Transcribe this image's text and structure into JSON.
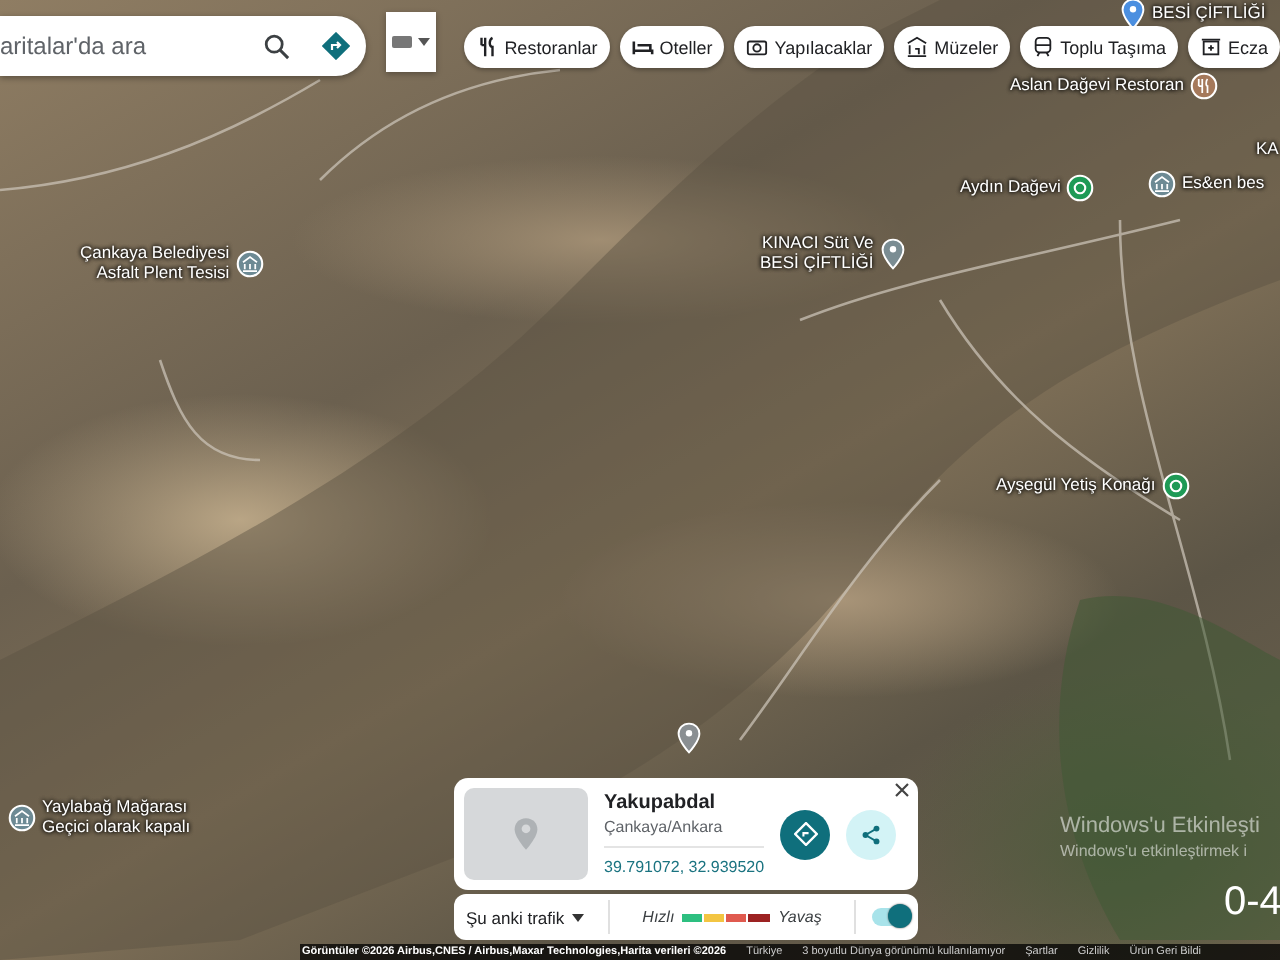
{
  "search": {
    "placeholder": "aritalar'da ara"
  },
  "chips": [
    {
      "label": "Restoranlar",
      "kind": "restaurant"
    },
    {
      "label": "Oteller",
      "kind": "hotel"
    },
    {
      "label": "Yapılacaklar",
      "kind": "camera"
    },
    {
      "label": "Müzeler",
      "kind": "museum"
    },
    {
      "label": "Toplu Taşıma",
      "kind": "transit"
    },
    {
      "label": "Ecza",
      "kind": "pharmacy"
    }
  ],
  "map_labels": [
    {
      "lines": [
        "BESİ ÇİFTLİĞİ"
      ],
      "kind": "pin",
      "color": "#4b8fe0"
    },
    {
      "lines": [
        "Aslan Dağevi Restoran"
      ],
      "kind": "restaurant",
      "color": "#a5795b"
    },
    {
      "lines": [
        "KA"
      ],
      "kind": "text"
    },
    {
      "lines": [
        "Aydın Dağevi"
      ],
      "kind": "lodging",
      "color": "#1e9a56"
    },
    {
      "lines": [
        "Es&en bes"
      ],
      "kind": "museum",
      "color": "#6d8a94"
    },
    {
      "lines": [
        "Çankaya Belediyesi",
        "Asfalt Plent Tesisi"
      ],
      "kind": "museum",
      "color": "#6d8a94"
    },
    {
      "lines": [
        "KINACI Süt Ve",
        "BESİ ÇİFTLİĞİ"
      ],
      "kind": "pin",
      "color": "#7b8d93"
    },
    {
      "lines": [
        "Ayşegül Yetiş Konağı"
      ],
      "kind": "lodging",
      "color": "#1e9a56"
    },
    {
      "kind": "pin",
      "color": "#8a8f92"
    },
    {
      "lines": [
        "Yaylabağ Mağarası",
        "Geçici olarak kapalı"
      ],
      "kind": "museum",
      "color": "#6d8a94"
    }
  ],
  "place": {
    "title": "Yakupabdal",
    "subtitle": "Çankaya/Ankara",
    "coordinates": "39.791072, 32.939520"
  },
  "traffic": {
    "label": "Şu anki trafik",
    "fast": "Hızlı",
    "slow": "Yavaş",
    "on": true
  },
  "scale_text": "0-4",
  "system_notice": [
    "Windows'u Etkinleşti",
    "Windows'u etkinleştirmek i"
  ],
  "footer": {
    "attribution": "Görüntüler ©2026 Airbus,CNES / Airbus,Maxar Technologies,Harita verileri ©2026",
    "links": [
      "Türkiye",
      "3 boyutlu Dünya görünümü kullanılamıyor",
      "Şartlar",
      "Gizlilik",
      "Ürün Geri Bildi"
    ]
  }
}
